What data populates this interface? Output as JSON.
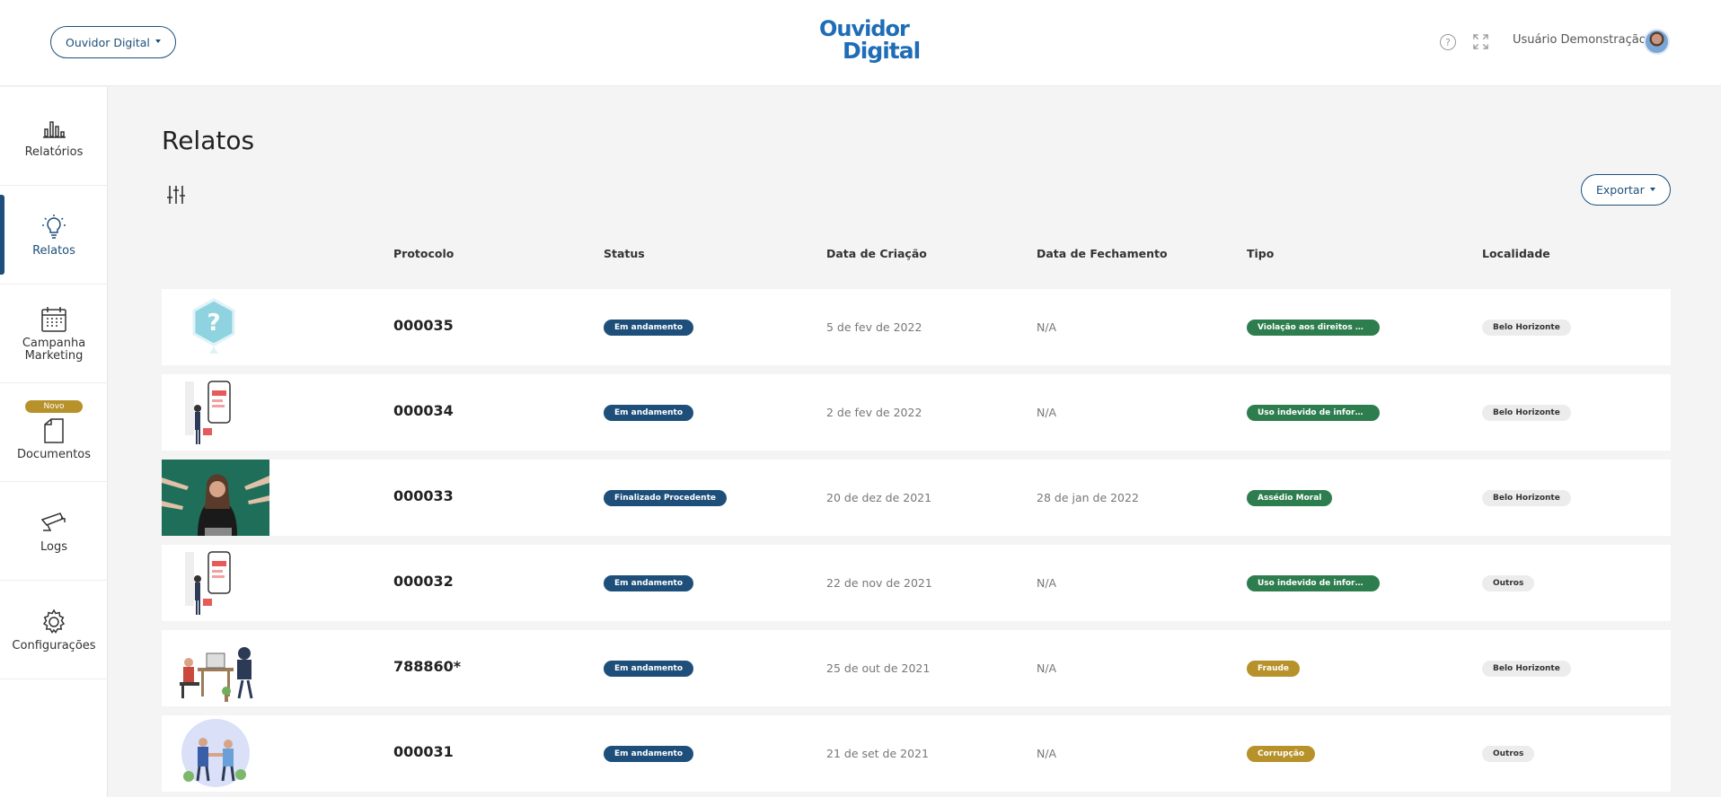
{
  "header": {
    "org_selector": "Ouvidor Digital",
    "logo_line1": "Ouvidor",
    "logo_line2": "Digital",
    "user_name": "Usuário Demonstração"
  },
  "sidebar": {
    "items": [
      {
        "label": "Relatórios",
        "icon": "bar-chart-icon"
      },
      {
        "label": "Relatos",
        "icon": "lightbulb-icon",
        "active": true
      },
      {
        "label": "Campanha Marketing",
        "icon": "calendar-icon"
      },
      {
        "label": "Documentos",
        "icon": "document-icon",
        "badge": "Novo"
      },
      {
        "label": "Logs",
        "icon": "camera-icon"
      },
      {
        "label": "Configurações",
        "icon": "gear-icon"
      }
    ]
  },
  "main": {
    "title": "Relatos",
    "export_label": "Exportar",
    "columns": [
      "Protocolo",
      "Status",
      "Data de Criação",
      "Data de Fechamento",
      "Tipo",
      "Localidade"
    ],
    "rows": [
      {
        "protocol": "000035",
        "status": "Em andamento",
        "created": "5 de fev de 2022",
        "closed": "N/A",
        "tipo": "Violação aos direitos hum...",
        "local": "Belo Horizonte"
      },
      {
        "protocol": "000034",
        "status": "Em andamento",
        "created": "2 de fev de 2022",
        "closed": "N/A",
        "tipo": "Uso indevido de informaçã...",
        "local": "Belo Horizonte"
      },
      {
        "protocol": "000033",
        "status": "Finalizado Procedente",
        "created": "20 de dez de 2021",
        "closed": "28 de jan de 2022",
        "tipo": "Assédio Moral",
        "local": "Belo Horizonte"
      },
      {
        "protocol": "000032",
        "status": "Em andamento",
        "created": "22 de nov de 2021",
        "closed": "N/A",
        "tipo": "Uso indevido de informaçã...",
        "local": "Outros"
      },
      {
        "protocol": "788860*",
        "status": "Em andamento",
        "created": "25 de out de 2021",
        "closed": "N/A",
        "tipo": "Fraude",
        "local": "Belo Horizonte"
      },
      {
        "protocol": "000031",
        "status": "Em andamento",
        "created": "21 de set de 2021",
        "closed": "N/A",
        "tipo": "Corrupção",
        "local": "Outros"
      }
    ]
  },
  "colors": {
    "primary": "#1e4f7a",
    "logo_blue": "#1e6db6",
    "tag_green": "#2e7d4f",
    "tag_gold": "#b7912a",
    "tag_gray": "#ececec"
  }
}
